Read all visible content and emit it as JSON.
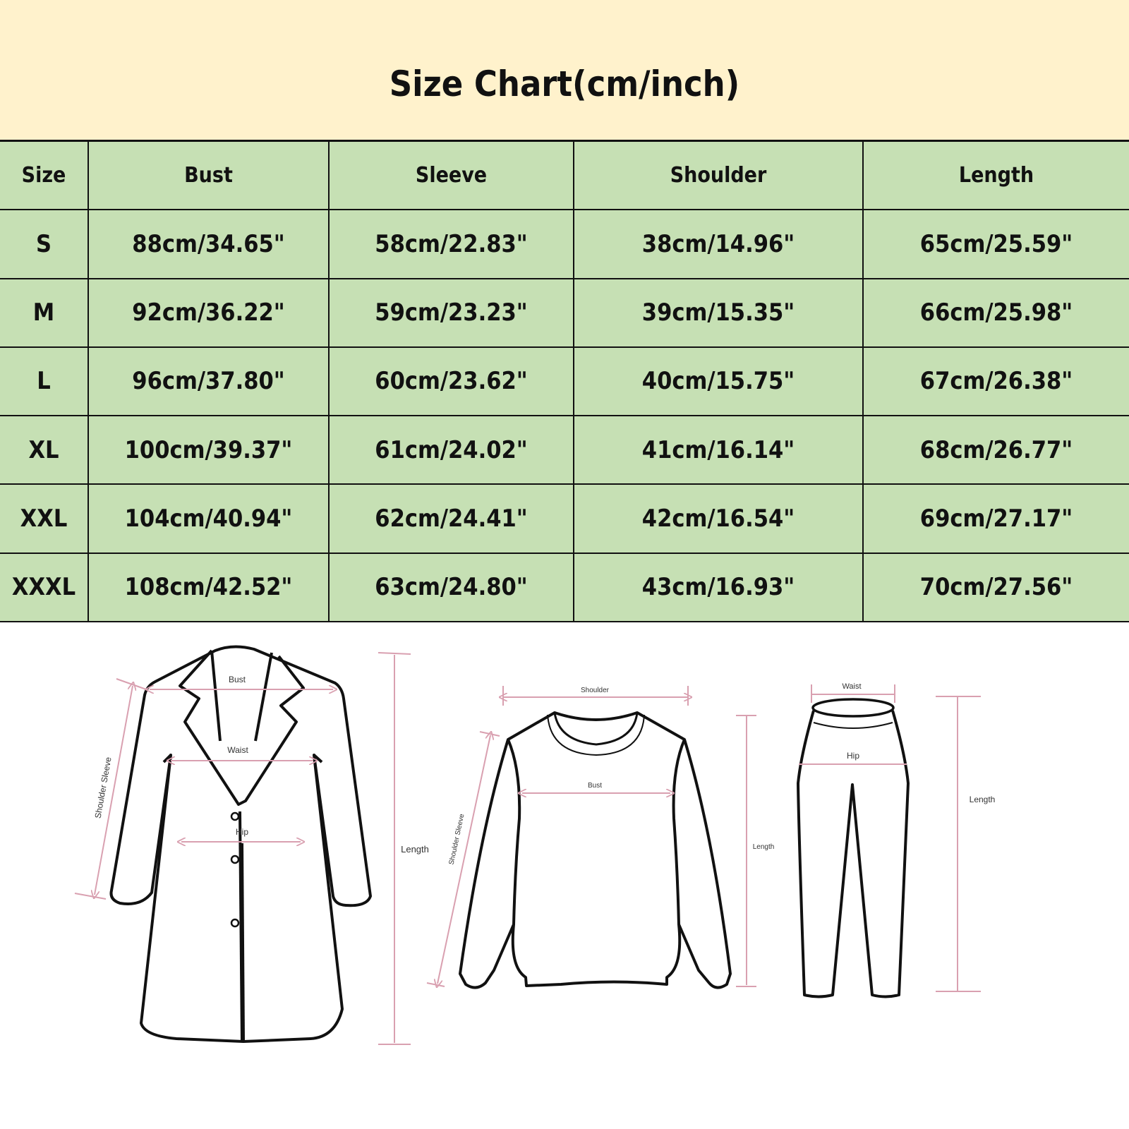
{
  "title": "Size Chart(cm/inch)",
  "colors": {
    "header_bg": "#fff2cc",
    "table_bg": "#c6e0b4",
    "measure_line": "#d9a0b0"
  },
  "table": {
    "columns": [
      "Size",
      "Bust",
      "Sleeve",
      "Shoulder",
      "Length"
    ],
    "rows": [
      {
        "size": "S",
        "bust": "88cm/34.65\"",
        "sleeve": "58cm/22.83\"",
        "shoulder": "38cm/14.96\"",
        "length": "65cm/25.59\""
      },
      {
        "size": "M",
        "bust": "92cm/36.22\"",
        "sleeve": "59cm/23.23\"",
        "shoulder": "39cm/15.35\"",
        "length": "66cm/25.98\""
      },
      {
        "size": "L",
        "bust": "96cm/37.80\"",
        "sleeve": "60cm/23.62\"",
        "shoulder": "40cm/15.75\"",
        "length": "67cm/26.38\""
      },
      {
        "size": "XL",
        "bust": "100cm/39.37\"",
        "sleeve": "61cm/24.02\"",
        "shoulder": "41cm/16.14\"",
        "length": "68cm/26.77\""
      },
      {
        "size": "XXL",
        "bust": "104cm/40.94\"",
        "sleeve": "62cm/24.41\"",
        "shoulder": "42cm/16.54\"",
        "length": "69cm/27.17\""
      },
      {
        "size": "XXXL",
        "bust": "108cm/42.52\"",
        "sleeve": "63cm/24.80\"",
        "shoulder": "43cm/16.93\"",
        "length": "70cm/27.56\""
      }
    ]
  },
  "diagrams": {
    "coat": {
      "bust": "Bust",
      "waist": "Waist",
      "hip": "Hip",
      "shoulder_sleeve": "Shoulder Sleeve",
      "length": "Length"
    },
    "sweater": {
      "shoulder": "Shoulder",
      "bust": "Bust",
      "shoulder_sleeve": "Shoulder Sleeve",
      "length": "Length"
    },
    "pants": {
      "waist": "Waist",
      "hip": "Hip",
      "length": "Length"
    }
  }
}
